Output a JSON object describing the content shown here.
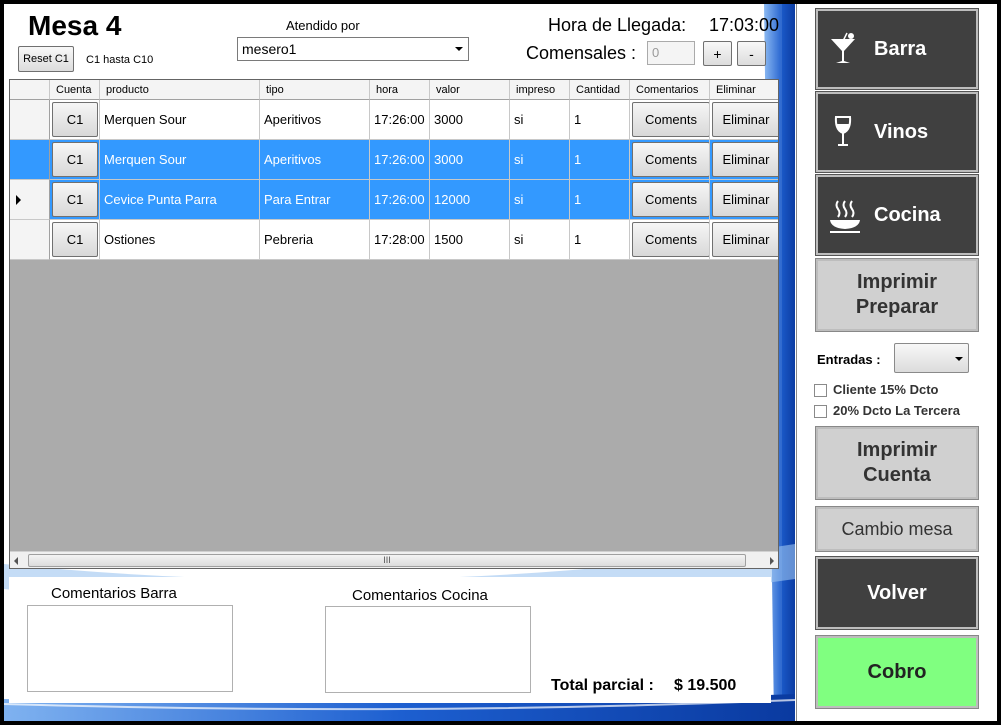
{
  "header": {
    "title": "Mesa 4",
    "reset_label": "Reset C1",
    "range_label": "C1 hasta C10",
    "atendido_label": "Atendido por",
    "waiter_selected": "mesero1",
    "hora_label": "Hora de Llegada:",
    "hora_value": "17:03:00",
    "comensales_label": "Comensales :",
    "comensales_value": "0",
    "plus_label": "+",
    "minus_label": "-"
  },
  "grid": {
    "columns": [
      "Cuenta",
      "producto",
      "tipo",
      "hora",
      "valor",
      "impreso",
      "Cantidad",
      "Comentarios",
      "Eliminar"
    ],
    "rows": [
      {
        "cuenta": "C1",
        "producto": "Merquen Sour",
        "tipo": "Aperitivos",
        "hora": "17:26:00",
        "valor": "3000",
        "impreso": "si",
        "cantidad": "1",
        "comentarios": "Coments",
        "eliminar": "Eliminar",
        "selected": false,
        "current": false
      },
      {
        "cuenta": "C1",
        "producto": "Merquen Sour",
        "tipo": "Aperitivos",
        "hora": "17:26:00",
        "valor": "3000",
        "impreso": "si",
        "cantidad": "1",
        "comentarios": "Coments",
        "eliminar": "Eliminar",
        "selected": true,
        "current": false
      },
      {
        "cuenta": "C1",
        "producto": "Cevice Punta Parra",
        "tipo": "Para Entrar",
        "hora": "17:26:00",
        "valor": "12000",
        "impreso": "si",
        "cantidad": "1",
        "comentarios": "Coments",
        "eliminar": "Eliminar",
        "selected": true,
        "current": true
      },
      {
        "cuenta": "C1",
        "producto": "Ostiones",
        "tipo": "Pebreria",
        "hora": "17:28:00",
        "valor": "1500",
        "impreso": "si",
        "cantidad": "1",
        "comentarios": "Coments",
        "eliminar": "Eliminar",
        "selected": false,
        "current": false
      }
    ],
    "scroll_grip": "III"
  },
  "comments": {
    "barra_label": "Comentarios Barra",
    "cocina_label": "Comentarios Cocina"
  },
  "total": {
    "label": "Total parcial :",
    "value": "$ 19.500"
  },
  "side": {
    "barra": "Barra",
    "vinos": "Vinos",
    "cocina": "Cocina",
    "imprimir_preparar_1": "Imprimir",
    "imprimir_preparar_2": "Preparar",
    "entradas_label": "Entradas :",
    "chk_cliente": "Cliente 15% Dcto",
    "chk_tercera": "20% Dcto La Tercera",
    "imprimir_cuenta_1": "Imprimir",
    "imprimir_cuenta_2": "Cuenta",
    "cambio_mesa": "Cambio mesa",
    "volver": "Volver",
    "cobro": "Cobro"
  },
  "colors": {
    "selection": "#3399ff",
    "dark_button": "#404040",
    "cobro_green": "#80ff80",
    "swoosh_blue": "#1a5cc8"
  }
}
